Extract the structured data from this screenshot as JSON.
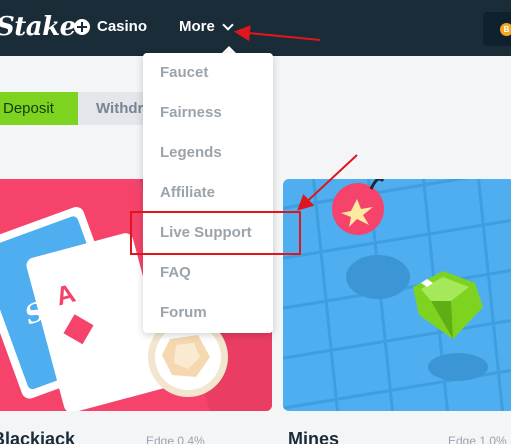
{
  "header": {
    "logo": "Stake",
    "nav": {
      "casino_label": "Casino",
      "casino_icon": "plus-circle-icon",
      "more_label": "More",
      "more_icon": "chevron-down-icon"
    },
    "wallet": {
      "coin_icon": "bitcoin-icon",
      "coin_symbol": "B"
    }
  },
  "wallet_tabs": {
    "deposit_label": "Deposit",
    "withdraw_label": "Withdraw"
  },
  "more_menu": {
    "items": [
      {
        "label": "Faucet"
      },
      {
        "label": "Fairness"
      },
      {
        "label": "Legends"
      },
      {
        "label": "Affiliate"
      },
      {
        "label": "Live Support"
      },
      {
        "label": "FAQ"
      },
      {
        "label": "Forum"
      }
    ]
  },
  "games": [
    {
      "title": "Blackjack",
      "edge": "Edge 0.4%"
    },
    {
      "title": "Mines",
      "edge": "Edge 1.0%"
    }
  ],
  "card_art": {
    "blackjack_card_letter": "A",
    "blackjack_card_brand": "Stake"
  },
  "colors": {
    "header_bg": "#1a2c38",
    "deposit_green": "#7ed321",
    "blackjack_card": "#f5436b",
    "mines_card": "#4eaef0",
    "annotation_red": "#e0161f"
  }
}
